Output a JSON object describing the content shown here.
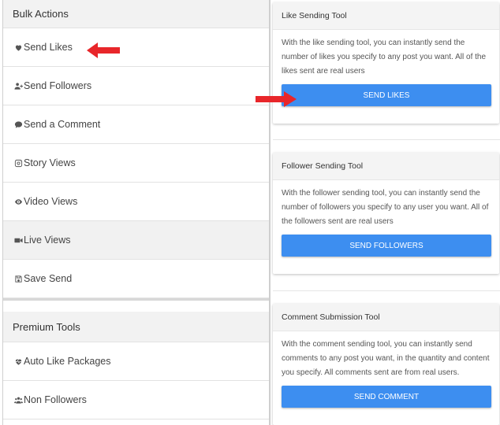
{
  "sidebar": {
    "bulk_title": "Bulk Actions",
    "items": [
      {
        "label": "Send Likes",
        "icon": "heart-icon"
      },
      {
        "label": "Send Followers",
        "icon": "user-plus-icon"
      },
      {
        "label": "Send a Comment",
        "icon": "comment-icon"
      },
      {
        "label": "Story Views",
        "icon": "instagram-icon"
      },
      {
        "label": "Video Views",
        "icon": "eye-icon"
      },
      {
        "label": " Live Views",
        "icon": "video-camera-icon"
      },
      {
        "label": "Save Send",
        "icon": "save-icon"
      }
    ],
    "premium_title": "Premium Tools",
    "premium_items": [
      {
        "label": "Auto Like Packages",
        "icon": "heartbeat-icon"
      },
      {
        "label": "Non Followers",
        "icon": "users-icon"
      }
    ]
  },
  "cards": [
    {
      "title": "Like Sending Tool",
      "text": "With the like sending tool, you can instantly send the number of likes you specify to any post you want. All of the likes sent are real users",
      "button": "SEND LIKES"
    },
    {
      "title": "Follower Sending Tool",
      "text": "With the follower sending tool, you can instantly send the number of followers you specify to any user you want. All of the followers sent are real users",
      "button": "SEND FOLLOWERS"
    },
    {
      "title": "Comment Submission Tool",
      "text": "With the comment sending tool, you can instantly send comments to any post you want, in the quantity and content you specify. All comments sent are from real users.",
      "button": "SEND COMMENT"
    }
  ],
  "colors": {
    "button": "#3d8ef0",
    "arrow": "#e8262a"
  }
}
